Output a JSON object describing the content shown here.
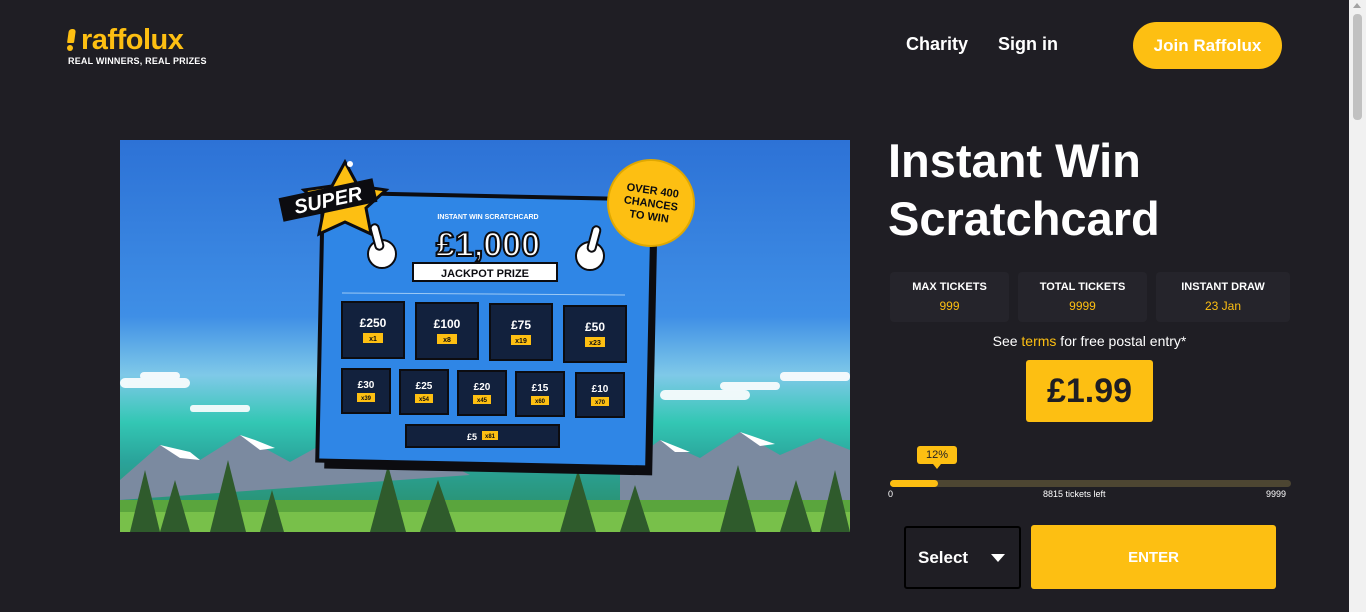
{
  "header": {
    "logo_text": "raffolux",
    "tagline": "REAL WINNERS, REAL PRIZES",
    "nav": {
      "charity": "Charity",
      "sign_in": "Sign in"
    },
    "join_button": "Join Raffolux"
  },
  "hero_image": {
    "super_badge": "SUPER",
    "card_heading": "INSTANT WIN SCRATCHCARD",
    "jackpot_amount": "£1,000",
    "jackpot_label": "JACKPOT PRIZE",
    "chances_badge": [
      "OVER 400",
      "CHANCES",
      "TO WIN"
    ],
    "prizes_row1": [
      {
        "amount": "£250",
        "count": "x1"
      },
      {
        "amount": "£100",
        "count": "x8"
      },
      {
        "amount": "£75",
        "count": "x19"
      },
      {
        "amount": "£50",
        "count": "x23"
      }
    ],
    "prizes_row2": [
      {
        "amount": "£30",
        "count": "x39"
      },
      {
        "amount": "£25",
        "count": "x54"
      },
      {
        "amount": "£20",
        "count": "x45"
      },
      {
        "amount": "£15",
        "count": "x60"
      },
      {
        "amount": "£10",
        "count": "x70"
      }
    ],
    "prize_row3": {
      "amount": "£5",
      "count": "x81"
    }
  },
  "competition": {
    "title_line1": "Instant Win",
    "title_line2": "Scratchcard",
    "stats": [
      {
        "label": "MAX TICKETS",
        "value": "999"
      },
      {
        "label": "TOTAL TICKETS",
        "value": "9999"
      },
      {
        "label": "INSTANT DRAW",
        "value": "23 Jan"
      }
    ],
    "terms_prefix": "See ",
    "terms_link": "terms",
    "terms_suffix": " for free postal entry*",
    "price": "£1.99",
    "progress": {
      "percent_label": "12%",
      "percent": 12,
      "min": "0",
      "max": "9999",
      "tickets_left": "8815 tickets left"
    },
    "select_label": "Select",
    "enter_button": "ENTER"
  },
  "colors": {
    "background": "#1f1e24",
    "accent": "#fdbf12",
    "card_blue": "#2f86e6"
  }
}
